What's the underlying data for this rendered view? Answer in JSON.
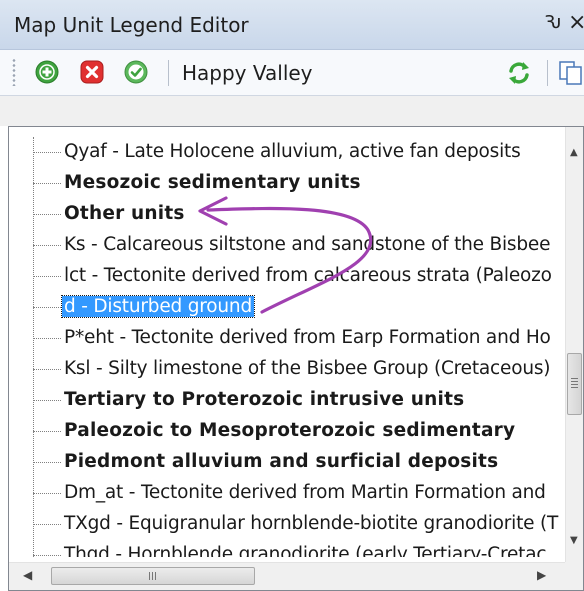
{
  "window": {
    "title": "Map Unit Legend Editor",
    "pin_glyph": "Ԅ",
    "close_glyph": "×"
  },
  "toolbar": {
    "map_name": "Happy Valley",
    "icons": [
      "add-icon",
      "delete-icon",
      "ok-icon",
      "refresh-icon",
      "copy-icon"
    ]
  },
  "tree": {
    "rows": [
      {
        "text": "Qyaf - Late Holocene alluvium, active fan deposits",
        "kind": "unit"
      },
      {
        "text": "Mesozoic sedimentary units",
        "kind": "group"
      },
      {
        "text": "Other units",
        "kind": "group"
      },
      {
        "text": "Ks - Calcareous siltstone and sandstone of the Bisbee",
        "kind": "unit"
      },
      {
        "text": "lct - Tectonite derived from calcareous strata (Paleozo",
        "kind": "unit"
      },
      {
        "text": "d - Disturbed ground",
        "kind": "unit",
        "selected": true
      },
      {
        "text": "P*eht - Tectonite derived from Earp Formation and Ho",
        "kind": "unit"
      },
      {
        "text": "Ksl - Silty limestone of the Bisbee Group (Cretaceous)",
        "kind": "unit"
      },
      {
        "text": "Tertiary to Proterozoic intrusive units",
        "kind": "group"
      },
      {
        "text": "Paleozoic to Mesoproterozoic sedimentary",
        "kind": "group"
      },
      {
        "text": "Piedmont alluvium and surficial deposits",
        "kind": "group"
      },
      {
        "text": "Dm_at - Tectonite derived from Martin Formation and",
        "kind": "unit"
      },
      {
        "text": "TXgd - Equigranular hornblende-biotite granodiorite (T",
        "kind": "unit"
      },
      {
        "text": "Thgd - Hornblende granodiorite (early Tertiary-Cretac",
        "kind": "unit"
      }
    ]
  },
  "scrollbar": {
    "h_grip": "III"
  },
  "colors": {
    "selection": "#3399ff",
    "arrow": "#a040b0",
    "add": "#3fa33f",
    "delete": "#e03030",
    "ok": "#5cb85c"
  }
}
